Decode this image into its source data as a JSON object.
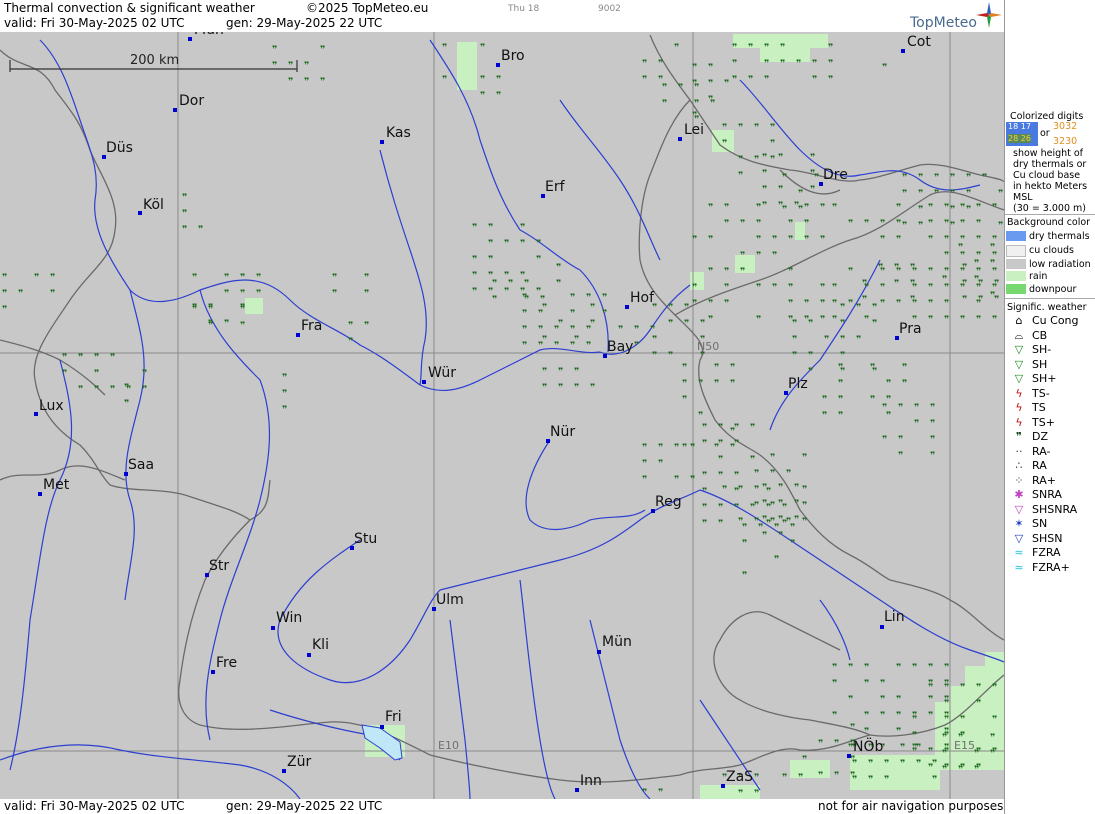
{
  "header": {
    "title": "Thermal convection & significant weather",
    "copyright": "©2025 TopMeteo.eu",
    "valid": "valid:  Fri  30-May-2025  02 UTC",
    "gen": "gen: 29-May-2025 22 UTC",
    "hud_left": "Thu 18",
    "hud_right": "9002",
    "logo": "TopMeteo"
  },
  "footer": {
    "valid": "valid:  Fri  30-May-2025  02 UTC",
    "gen": "gen: 29-May-2025 22 UTC",
    "disclaimer": "not for air navigation purposes"
  },
  "map": {
    "scale_label": "200 km",
    "grid_labels": {
      "n50": "N50",
      "e10": "E10",
      "e15": "E15"
    },
    "colors": {
      "background": "#c8c8c8",
      "rain": "#c8f0c0",
      "drizzle": "#1d6a1d",
      "river": "#2c3fd0",
      "border": "#6a6a6a",
      "grid": "#8a8a8a",
      "city": "#0000d0"
    },
    "cities": [
      {
        "name": "Mün",
        "label": "Mün"
      },
      {
        "name": "Bro",
        "label": "Bro"
      },
      {
        "name": "Cot",
        "label": "Cot"
      },
      {
        "name": "Dor",
        "label": "Dor"
      },
      {
        "name": "Kas",
        "label": "Kas"
      },
      {
        "name": "Lei",
        "label": "Lei"
      },
      {
        "name": "Düs",
        "label": "Düs"
      },
      {
        "name": "Dre",
        "label": "Dre"
      },
      {
        "name": "Erf",
        "label": "Erf"
      },
      {
        "name": "Köl",
        "label": "Köl"
      },
      {
        "name": "Hof",
        "label": "Hof"
      },
      {
        "name": "Fra",
        "label": "Fra"
      },
      {
        "name": "Pra",
        "label": "Pra"
      },
      {
        "name": "Bay",
        "label": "Bay"
      },
      {
        "name": "Wür",
        "label": "Wür"
      },
      {
        "name": "Plz",
        "label": "Plz"
      },
      {
        "name": "Lux",
        "label": "Lux"
      },
      {
        "name": "Nür",
        "label": "Nür"
      },
      {
        "name": "Saa",
        "label": "Saa"
      },
      {
        "name": "Met",
        "label": "Met"
      },
      {
        "name": "Reg",
        "label": "Reg"
      },
      {
        "name": "Stu",
        "label": "Stu"
      },
      {
        "name": "Str",
        "label": "Str"
      },
      {
        "name": "Ulm",
        "label": "Ulm"
      },
      {
        "name": "Win",
        "label": "Win"
      },
      {
        "name": "Lin",
        "label": "Lin"
      },
      {
        "name": "Kli",
        "label": "Kli"
      },
      {
        "name": "Mün2",
        "label": "Mün"
      },
      {
        "name": "Fre",
        "label": "Fre"
      },
      {
        "name": "Fri",
        "label": "Fri"
      },
      {
        "name": "NÖb",
        "label": "NÖb"
      },
      {
        "name": "Zür",
        "label": "Zür"
      },
      {
        "name": "Inn",
        "label": "Inn"
      },
      {
        "name": "ZaS",
        "label": "ZaS"
      }
    ]
  },
  "legend": {
    "digits_title": [
      "Colorized digits"
    ],
    "digits_sample_a": [
      "18 17",
      "28 26"
    ],
    "digits_or": "or",
    "digits_sample_b": [
      "3032",
      "3230"
    ],
    "digits_desc": [
      "show height of",
      "dry thermals or",
      "Cu cloud base",
      "in hekto Meters",
      "MSL",
      "(30 = 3.000 m)"
    ],
    "bg_title": "Background color",
    "bg_items": [
      {
        "label": "dry thermals",
        "color": "#6a9af0"
      },
      {
        "label": "cu clouds",
        "color": "#f0f0f0"
      },
      {
        "label": "low radiation",
        "color": "#c8c8c8"
      },
      {
        "label": "rain",
        "color": "#c8f0c0"
      },
      {
        "label": "downpour",
        "color": "#78d870"
      }
    ],
    "wx_title": "Signific. weather",
    "wx_items": [
      {
        "label": "Cu Cong",
        "symbol": "⌂",
        "color": "#000000"
      },
      {
        "label": "CB",
        "symbol": "⌓",
        "color": "#000000"
      },
      {
        "label": "SH-",
        "symbol": "▽",
        "color": "#1d8a1d"
      },
      {
        "label": "SH",
        "symbol": "▽",
        "color": "#1d8a1d"
      },
      {
        "label": "SH+",
        "symbol": "▽",
        "color": "#1d8a1d"
      },
      {
        "label": "TS-",
        "symbol": "ϟ",
        "color": "#c01010"
      },
      {
        "label": "TS",
        "symbol": "ϟ",
        "color": "#c01010"
      },
      {
        "label": "TS+",
        "symbol": "ϟ",
        "color": "#c01010"
      },
      {
        "label": "DZ",
        "symbol": "❞",
        "color": "#1d4a1d"
      },
      {
        "label": "RA-",
        "symbol": "··",
        "color": "#1d4a1d"
      },
      {
        "label": "RA",
        "symbol": "∴",
        "color": "#1d4a1d"
      },
      {
        "label": "RA+",
        "symbol": "⁘",
        "color": "#1d4a1d"
      },
      {
        "label": "SNRA",
        "symbol": "✱",
        "color": "#c040c0"
      },
      {
        "label": "SHSNRA",
        "symbol": "▽",
        "color": "#c040c0"
      },
      {
        "label": "SN",
        "symbol": "✶",
        "color": "#2040c0"
      },
      {
        "label": "SHSN",
        "symbol": "▽",
        "color": "#2040c0"
      },
      {
        "label": "FZRA",
        "symbol": "≈",
        "color": "#20c0e0"
      },
      {
        "label": "FZRA+",
        "symbol": "≈",
        "color": "#20c0e0"
      }
    ]
  }
}
